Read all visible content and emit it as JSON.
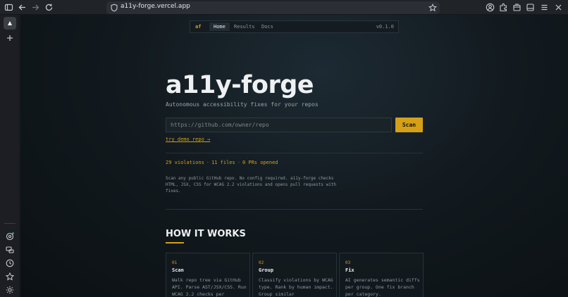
{
  "browser": {
    "url": "a11y-forge.vercel.app"
  },
  "nav": {
    "brand": "af",
    "home": "Home",
    "results": "Results",
    "docs": "Docs",
    "version": "v0.1.0"
  },
  "hero": {
    "title": "a11y-forge",
    "subtitle": "Autonomous accessibility fixes for your repos",
    "input_placeholder": "https://github.com/owner/repo",
    "scan_label": "Scan",
    "demo_link": "try demo repo →"
  },
  "stats": {
    "violations": "29 violations",
    "files": "11 files",
    "prs": "0 PRs opened"
  },
  "description": "Scan any public GitHub repo. No config required. a11y-forge checks HTML, JSX, CSS for WCAG 2.2 violations and opens pull requests with fixes.",
  "how": {
    "title": "HOW IT WORKS",
    "steps": [
      {
        "num": "01",
        "title": "Scan",
        "body": "Walk repo tree via GitHub API. Parse AST/JSX/CSS. Run WCAG 2.2 checks per"
      },
      {
        "num": "02",
        "title": "Group",
        "body": "Classify violations by WCAG type. Rank by human impact. Group similar"
      },
      {
        "num": "03",
        "title": "Fix",
        "body": "AI generates semantic diffs per group. One fix branch per category."
      }
    ]
  },
  "colors": {
    "accent": "#d4a017",
    "page_bg": "#0b1013"
  }
}
